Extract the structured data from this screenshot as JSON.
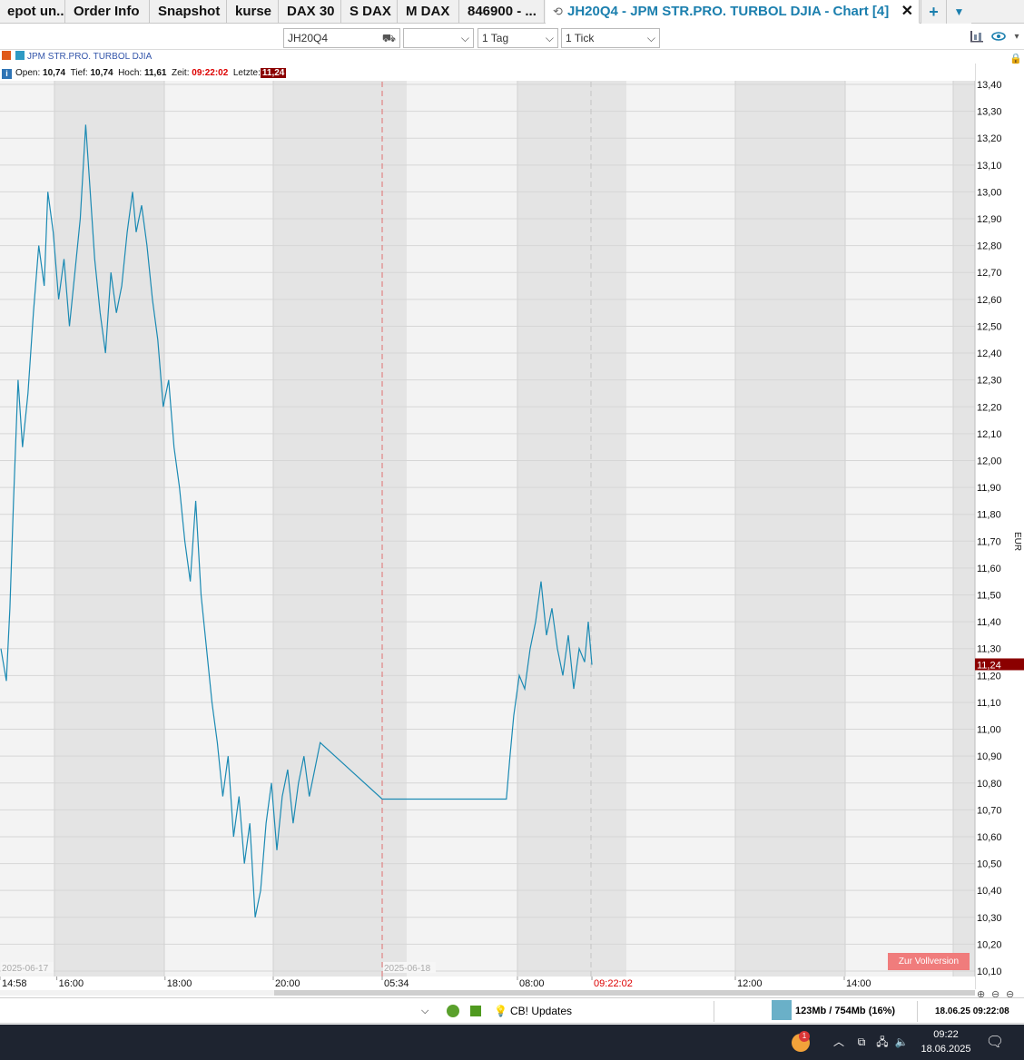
{
  "tabs": [
    {
      "label": "epot un..."
    },
    {
      "label": "Order Info"
    },
    {
      "label": "Snapshot"
    },
    {
      "label": "kurse"
    },
    {
      "label": "DAX 30"
    },
    {
      "label": "S DAX"
    },
    {
      "label": "M DAX"
    },
    {
      "label": "846900 - ..."
    },
    {
      "label": "JH20Q4 - JPM STR.PRO. TURBOL DJIA - Chart [4]",
      "active": true
    }
  ],
  "tab_buttons": {
    "add": "+",
    "menu": "▼",
    "close": "✕"
  },
  "toolbar": {
    "symbol_value": "JH20Q4",
    "select2_value": "",
    "period_value": "1 Tag",
    "interval_value": "1 Tick"
  },
  "legend": {
    "name": "JPM STR.PRO. TURBOL DJIA"
  },
  "info": {
    "open_label": "Open:",
    "open": "10,74",
    "low_label": "Tief:",
    "low": "10,74",
    "high_label": "Hoch:",
    "high": "11,61",
    "time_label": "Zeit:",
    "time": "09:22:02",
    "last_label": "Letzte:",
    "last": "11,24"
  },
  "chart_data": {
    "type": "line",
    "title": "JPM STR.PRO. TURBOL DJIA",
    "xlabel": "",
    "ylabel": "EUR",
    "ylim": [
      10.1,
      13.4
    ],
    "yticks": [
      "13,40",
      "13,30",
      "13,20",
      "13,10",
      "13,00",
      "12,90",
      "12,80",
      "12,70",
      "12,60",
      "12,50",
      "12,40",
      "12,30",
      "12,20",
      "12,10",
      "12,00",
      "11,90",
      "11,80",
      "11,70",
      "11,60",
      "11,50",
      "11,40",
      "11,30",
      "11,20",
      "11,10",
      "11,00",
      "10,90",
      "10,80",
      "10,70",
      "10,60",
      "10,50",
      "10,40",
      "10,30",
      "10,20",
      "10,10"
    ],
    "xticks": [
      {
        "time": "14:58",
        "label": "14:58"
      },
      {
        "time": "16:00",
        "label": "16:00"
      },
      {
        "time": "18:00",
        "label": "18:00"
      },
      {
        "time": "20:00",
        "label": "20:00"
      },
      {
        "time": "05:34",
        "label": "05:34"
      },
      {
        "time": "08:00",
        "label": "08:00"
      },
      {
        "time": "09:22:02",
        "label": "09:22:02",
        "highlight": true
      },
      {
        "time": "12:00",
        "label": "12:00"
      },
      {
        "time": "14:00",
        "label": "14:00"
      }
    ],
    "date_labels": [
      {
        "time": "14:58",
        "label": "2025-06-17"
      },
      {
        "time": "05:34",
        "label": "2025-06-18"
      }
    ],
    "last_value_badge": "11,24",
    "series": [
      {
        "name": "JPM STR.PRO. TURBOL DJIA",
        "color": "#1b8ab3",
        "points": [
          [
            "14:58",
            11.3
          ],
          [
            "15:04",
            11.18
          ],
          [
            "15:08",
            11.45
          ],
          [
            "15:12",
            11.85
          ],
          [
            "15:17",
            12.3
          ],
          [
            "15:22",
            12.05
          ],
          [
            "15:28",
            12.25
          ],
          [
            "15:34",
            12.55
          ],
          [
            "15:40",
            12.8
          ],
          [
            "15:46",
            12.65
          ],
          [
            "15:50",
            13.0
          ],
          [
            "15:56",
            12.85
          ],
          [
            "16:02",
            12.6
          ],
          [
            "16:08",
            12.75
          ],
          [
            "16:14",
            12.5
          ],
          [
            "16:20",
            12.7
          ],
          [
            "16:26",
            12.9
          ],
          [
            "16:32",
            13.25
          ],
          [
            "16:36",
            13.05
          ],
          [
            "16:42",
            12.75
          ],
          [
            "16:48",
            12.55
          ],
          [
            "16:54",
            12.4
          ],
          [
            "17:00",
            12.7
          ],
          [
            "17:06",
            12.55
          ],
          [
            "17:12",
            12.65
          ],
          [
            "17:18",
            12.85
          ],
          [
            "17:24",
            13.0
          ],
          [
            "17:28",
            12.85
          ],
          [
            "17:34",
            12.95
          ],
          [
            "17:40",
            12.8
          ],
          [
            "17:46",
            12.6
          ],
          [
            "17:52",
            12.45
          ],
          [
            "17:58",
            12.2
          ],
          [
            "18:04",
            12.3
          ],
          [
            "18:10",
            12.05
          ],
          [
            "18:16",
            11.9
          ],
          [
            "18:22",
            11.7
          ],
          [
            "18:28",
            11.55
          ],
          [
            "18:34",
            11.85
          ],
          [
            "18:40",
            11.5
          ],
          [
            "18:46",
            11.3
          ],
          [
            "18:52",
            11.1
          ],
          [
            "18:58",
            10.95
          ],
          [
            "19:04",
            10.75
          ],
          [
            "19:10",
            10.9
          ],
          [
            "19:16",
            10.6
          ],
          [
            "19:22",
            10.75
          ],
          [
            "19:28",
            10.5
          ],
          [
            "19:34",
            10.65
          ],
          [
            "19:40",
            10.3
          ],
          [
            "19:46",
            10.4
          ],
          [
            "19:52",
            10.65
          ],
          [
            "19:58",
            10.8
          ],
          [
            "20:04",
            10.55
          ],
          [
            "20:10",
            10.75
          ],
          [
            "20:16",
            10.85
          ],
          [
            "20:22",
            10.65
          ],
          [
            "20:28",
            10.8
          ],
          [
            "20:34",
            10.9
          ],
          [
            "20:40",
            10.75
          ],
          [
            "20:46",
            10.85
          ],
          [
            "20:52",
            10.95
          ],
          [
            "05:34",
            10.74
          ],
          [
            "07:48",
            10.74
          ],
          [
            "07:52",
            10.9
          ],
          [
            "07:56",
            11.05
          ],
          [
            "08:02",
            11.2
          ],
          [
            "08:08",
            11.15
          ],
          [
            "08:14",
            11.3
          ],
          [
            "08:20",
            11.4
          ],
          [
            "08:26",
            11.55
          ],
          [
            "08:32",
            11.35
          ],
          [
            "08:38",
            11.45
          ],
          [
            "08:44",
            11.3
          ],
          [
            "08:50",
            11.2
          ],
          [
            "08:56",
            11.35
          ],
          [
            "09:02",
            11.15
          ],
          [
            "09:08",
            11.3
          ],
          [
            "09:14",
            11.25
          ],
          [
            "09:18",
            11.4
          ],
          [
            "09:22",
            11.24
          ]
        ]
      }
    ]
  },
  "zur_button": "Zur Vollversion",
  "statusbar": {
    "cb_updates": "CB! Updates",
    "memory": "123Mb / 754Mb (16%)",
    "datetime": "18.06.25 09:22:08"
  },
  "taskbar": {
    "weather_badge": "1",
    "clock_time": "09:22",
    "clock_date": "18.06.2025"
  }
}
